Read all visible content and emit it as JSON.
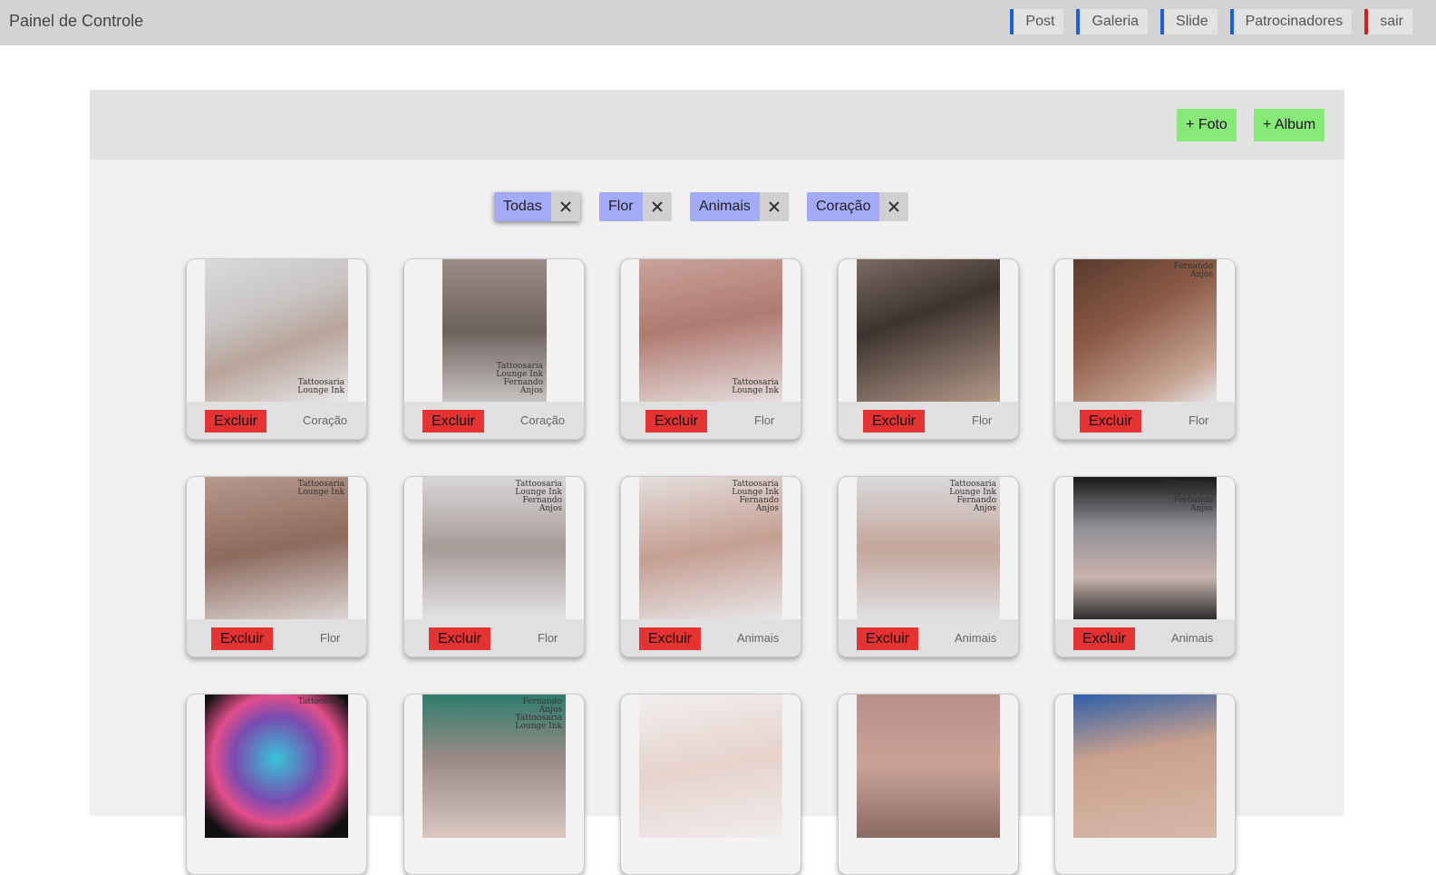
{
  "header": {
    "title": "Painel de Controle",
    "nav": [
      {
        "label": "Post",
        "accent": "#1a5fe0"
      },
      {
        "label": "Galeria",
        "accent": "#1a5fe0"
      },
      {
        "label": "Slide",
        "accent": "#1a5fe0"
      },
      {
        "label": "Patrocinadores",
        "accent": "#1a5fe0"
      },
      {
        "label": "sair",
        "accent": "#d42020"
      }
    ]
  },
  "toolbar": {
    "add_photo_label": "+ Foto",
    "add_album_label": "+ Album"
  },
  "filters": [
    {
      "label": "Todas",
      "active": true
    },
    {
      "label": "Flor",
      "active": false
    },
    {
      "label": "Animais",
      "active": false
    },
    {
      "label": "Coração",
      "active": false
    }
  ],
  "gallery": {
    "delete_label": "Excluir",
    "items": [
      {
        "category": "Coração",
        "watermark": [
          "Tattoosaria",
          "Lounge Ink"
        ]
      },
      {
        "category": "Coração",
        "watermark": [
          "Tattoosaria",
          "Lounge Ink",
          "Fernando",
          "Anjos"
        ]
      },
      {
        "category": "Flor",
        "watermark": [
          "Tattoosaria",
          "Lounge Ink"
        ]
      },
      {
        "category": "Flor",
        "watermark": []
      },
      {
        "category": "Flor",
        "watermark": [
          "Fernando",
          "Anjos"
        ]
      },
      {
        "category": "Flor",
        "watermark": [
          "Tattoosaria",
          "Lounge Ink"
        ]
      },
      {
        "category": "Flor",
        "watermark": [
          "Tattoosaria",
          "Lounge Ink",
          "Fernando",
          "Anjos"
        ]
      },
      {
        "category": "Animais",
        "watermark": [
          "Tattoosaria",
          "Lounge Ink",
          "Fernando",
          "Anjos"
        ]
      },
      {
        "category": "Animais",
        "watermark": [
          "Tattoosaria",
          "Lounge Ink",
          "Fernando",
          "Anjos"
        ]
      },
      {
        "category": "Animais",
        "watermark": [
          "Tattoosaria",
          "Lounge Ink",
          "Fernando",
          "Anjos"
        ]
      },
      {
        "category": "",
        "watermark": [
          "Tattoosaria"
        ]
      },
      {
        "category": "",
        "watermark": [
          "Fernando",
          "Anjos",
          "Tattoosaria",
          "Lounge Ink"
        ]
      },
      {
        "category": "",
        "watermark": []
      },
      {
        "category": "",
        "watermark": []
      },
      {
        "category": "",
        "watermark": []
      }
    ]
  },
  "colors": {
    "chip": "#a3aaf8",
    "green_button": "#87e978",
    "delete_button": "#e53232"
  }
}
